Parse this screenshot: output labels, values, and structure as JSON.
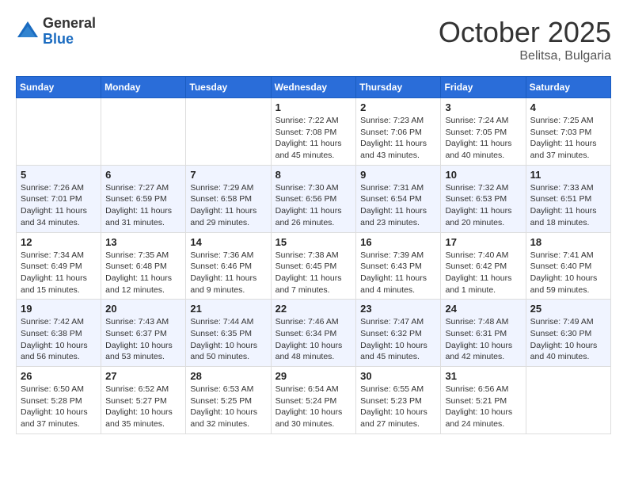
{
  "header": {
    "logo_general": "General",
    "logo_blue": "Blue",
    "month_title": "October 2025",
    "location": "Belitsa, Bulgaria"
  },
  "weekdays": [
    "Sunday",
    "Monday",
    "Tuesday",
    "Wednesday",
    "Thursday",
    "Friday",
    "Saturday"
  ],
  "weeks": [
    [
      {
        "day": "",
        "sunrise": "",
        "sunset": "",
        "daylight": ""
      },
      {
        "day": "",
        "sunrise": "",
        "sunset": "",
        "daylight": ""
      },
      {
        "day": "",
        "sunrise": "",
        "sunset": "",
        "daylight": ""
      },
      {
        "day": "1",
        "sunrise": "Sunrise: 7:22 AM",
        "sunset": "Sunset: 7:08 PM",
        "daylight": "Daylight: 11 hours and 45 minutes."
      },
      {
        "day": "2",
        "sunrise": "Sunrise: 7:23 AM",
        "sunset": "Sunset: 7:06 PM",
        "daylight": "Daylight: 11 hours and 43 minutes."
      },
      {
        "day": "3",
        "sunrise": "Sunrise: 7:24 AM",
        "sunset": "Sunset: 7:05 PM",
        "daylight": "Daylight: 11 hours and 40 minutes."
      },
      {
        "day": "4",
        "sunrise": "Sunrise: 7:25 AM",
        "sunset": "Sunset: 7:03 PM",
        "daylight": "Daylight: 11 hours and 37 minutes."
      }
    ],
    [
      {
        "day": "5",
        "sunrise": "Sunrise: 7:26 AM",
        "sunset": "Sunset: 7:01 PM",
        "daylight": "Daylight: 11 hours and 34 minutes."
      },
      {
        "day": "6",
        "sunrise": "Sunrise: 7:27 AM",
        "sunset": "Sunset: 6:59 PM",
        "daylight": "Daylight: 11 hours and 31 minutes."
      },
      {
        "day": "7",
        "sunrise": "Sunrise: 7:29 AM",
        "sunset": "Sunset: 6:58 PM",
        "daylight": "Daylight: 11 hours and 29 minutes."
      },
      {
        "day": "8",
        "sunrise": "Sunrise: 7:30 AM",
        "sunset": "Sunset: 6:56 PM",
        "daylight": "Daylight: 11 hours and 26 minutes."
      },
      {
        "day": "9",
        "sunrise": "Sunrise: 7:31 AM",
        "sunset": "Sunset: 6:54 PM",
        "daylight": "Daylight: 11 hours and 23 minutes."
      },
      {
        "day": "10",
        "sunrise": "Sunrise: 7:32 AM",
        "sunset": "Sunset: 6:53 PM",
        "daylight": "Daylight: 11 hours and 20 minutes."
      },
      {
        "day": "11",
        "sunrise": "Sunrise: 7:33 AM",
        "sunset": "Sunset: 6:51 PM",
        "daylight": "Daylight: 11 hours and 18 minutes."
      }
    ],
    [
      {
        "day": "12",
        "sunrise": "Sunrise: 7:34 AM",
        "sunset": "Sunset: 6:49 PM",
        "daylight": "Daylight: 11 hours and 15 minutes."
      },
      {
        "day": "13",
        "sunrise": "Sunrise: 7:35 AM",
        "sunset": "Sunset: 6:48 PM",
        "daylight": "Daylight: 11 hours and 12 minutes."
      },
      {
        "day": "14",
        "sunrise": "Sunrise: 7:36 AM",
        "sunset": "Sunset: 6:46 PM",
        "daylight": "Daylight: 11 hours and 9 minutes."
      },
      {
        "day": "15",
        "sunrise": "Sunrise: 7:38 AM",
        "sunset": "Sunset: 6:45 PM",
        "daylight": "Daylight: 11 hours and 7 minutes."
      },
      {
        "day": "16",
        "sunrise": "Sunrise: 7:39 AM",
        "sunset": "Sunset: 6:43 PM",
        "daylight": "Daylight: 11 hours and 4 minutes."
      },
      {
        "day": "17",
        "sunrise": "Sunrise: 7:40 AM",
        "sunset": "Sunset: 6:42 PM",
        "daylight": "Daylight: 11 hours and 1 minute."
      },
      {
        "day": "18",
        "sunrise": "Sunrise: 7:41 AM",
        "sunset": "Sunset: 6:40 PM",
        "daylight": "Daylight: 10 hours and 59 minutes."
      }
    ],
    [
      {
        "day": "19",
        "sunrise": "Sunrise: 7:42 AM",
        "sunset": "Sunset: 6:38 PM",
        "daylight": "Daylight: 10 hours and 56 minutes."
      },
      {
        "day": "20",
        "sunrise": "Sunrise: 7:43 AM",
        "sunset": "Sunset: 6:37 PM",
        "daylight": "Daylight: 10 hours and 53 minutes."
      },
      {
        "day": "21",
        "sunrise": "Sunrise: 7:44 AM",
        "sunset": "Sunset: 6:35 PM",
        "daylight": "Daylight: 10 hours and 50 minutes."
      },
      {
        "day": "22",
        "sunrise": "Sunrise: 7:46 AM",
        "sunset": "Sunset: 6:34 PM",
        "daylight": "Daylight: 10 hours and 48 minutes."
      },
      {
        "day": "23",
        "sunrise": "Sunrise: 7:47 AM",
        "sunset": "Sunset: 6:32 PM",
        "daylight": "Daylight: 10 hours and 45 minutes."
      },
      {
        "day": "24",
        "sunrise": "Sunrise: 7:48 AM",
        "sunset": "Sunset: 6:31 PM",
        "daylight": "Daylight: 10 hours and 42 minutes."
      },
      {
        "day": "25",
        "sunrise": "Sunrise: 7:49 AM",
        "sunset": "Sunset: 6:30 PM",
        "daylight": "Daylight: 10 hours and 40 minutes."
      }
    ],
    [
      {
        "day": "26",
        "sunrise": "Sunrise: 6:50 AM",
        "sunset": "Sunset: 5:28 PM",
        "daylight": "Daylight: 10 hours and 37 minutes."
      },
      {
        "day": "27",
        "sunrise": "Sunrise: 6:52 AM",
        "sunset": "Sunset: 5:27 PM",
        "daylight": "Daylight: 10 hours and 35 minutes."
      },
      {
        "day": "28",
        "sunrise": "Sunrise: 6:53 AM",
        "sunset": "Sunset: 5:25 PM",
        "daylight": "Daylight: 10 hours and 32 minutes."
      },
      {
        "day": "29",
        "sunrise": "Sunrise: 6:54 AM",
        "sunset": "Sunset: 5:24 PM",
        "daylight": "Daylight: 10 hours and 30 minutes."
      },
      {
        "day": "30",
        "sunrise": "Sunrise: 6:55 AM",
        "sunset": "Sunset: 5:23 PM",
        "daylight": "Daylight: 10 hours and 27 minutes."
      },
      {
        "day": "31",
        "sunrise": "Sunrise: 6:56 AM",
        "sunset": "Sunset: 5:21 PM",
        "daylight": "Daylight: 10 hours and 24 minutes."
      },
      {
        "day": "",
        "sunrise": "",
        "sunset": "",
        "daylight": ""
      }
    ]
  ]
}
